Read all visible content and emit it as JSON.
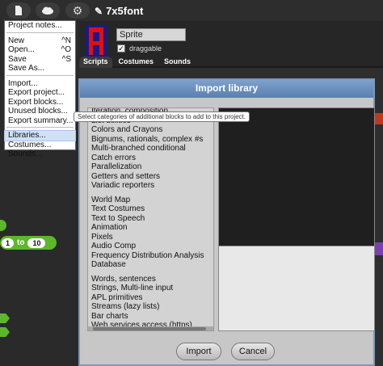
{
  "topbar": {
    "file_icon": "file-icon",
    "cloud_icon": "cloud-icon",
    "gear_icon": "gear-icon",
    "project_title": "7x5font"
  },
  "sprite": {
    "name": "Sprite",
    "draggable_label": "draggable",
    "tabs": [
      "Scripts",
      "Costumes",
      "Sounds"
    ]
  },
  "blocks": {
    "for_from": "1",
    "for_to_label": "to",
    "for_to": "10"
  },
  "file_menu": {
    "items": [
      {
        "label": "Project notes...",
        "shortcut": ""
      },
      {
        "sep": true
      },
      {
        "label": "New",
        "shortcut": "^N"
      },
      {
        "label": "Open...",
        "shortcut": "^O"
      },
      {
        "label": "Save",
        "shortcut": "^S"
      },
      {
        "label": "Save As...",
        "shortcut": ""
      },
      {
        "sep": true
      },
      {
        "label": "Import...",
        "shortcut": ""
      },
      {
        "label": "Export project...",
        "shortcut": ""
      },
      {
        "label": "Export blocks...",
        "shortcut": ""
      },
      {
        "label": "Unused blocks...",
        "shortcut": ""
      },
      {
        "label": "Export summary...",
        "shortcut": ""
      },
      {
        "sep": true
      },
      {
        "label": "Libraries...",
        "shortcut": "",
        "highlight": true
      },
      {
        "label": "Costumes...",
        "shortcut": ""
      },
      {
        "label": "Sounds...",
        "shortcut": ""
      }
    ]
  },
  "tooltip": "Select categories of additional blocks to add to this project.",
  "dialog": {
    "title": "Import library",
    "libraries": [
      [
        "Iteration, composition",
        "List utilities",
        "Colors and Crayons",
        "Bignums, rationals, complex #s",
        "Multi-branched conditional",
        "Catch errors",
        "Parallelization",
        "Getters and setters",
        "Variadic reporters"
      ],
      [
        "World Map",
        "Text Costumes",
        "Text to Speech",
        "Animation",
        "Pixels",
        "Audio Comp",
        "Frequency Distribution Analysis",
        "Database"
      ],
      [
        "Words, sentences",
        "Strings, Multi-line input",
        "APL primitives",
        "Streams (lazy lists)",
        "Bar charts",
        "Web services access (https)"
      ]
    ],
    "import_label": "Import",
    "cancel_label": "Cancel"
  },
  "colors": {
    "dialog_title_bg": "#6b8fc0",
    "highlight": "#cfe0f7",
    "block_green": "#5bb82a",
    "block_red": "#c2381f"
  }
}
